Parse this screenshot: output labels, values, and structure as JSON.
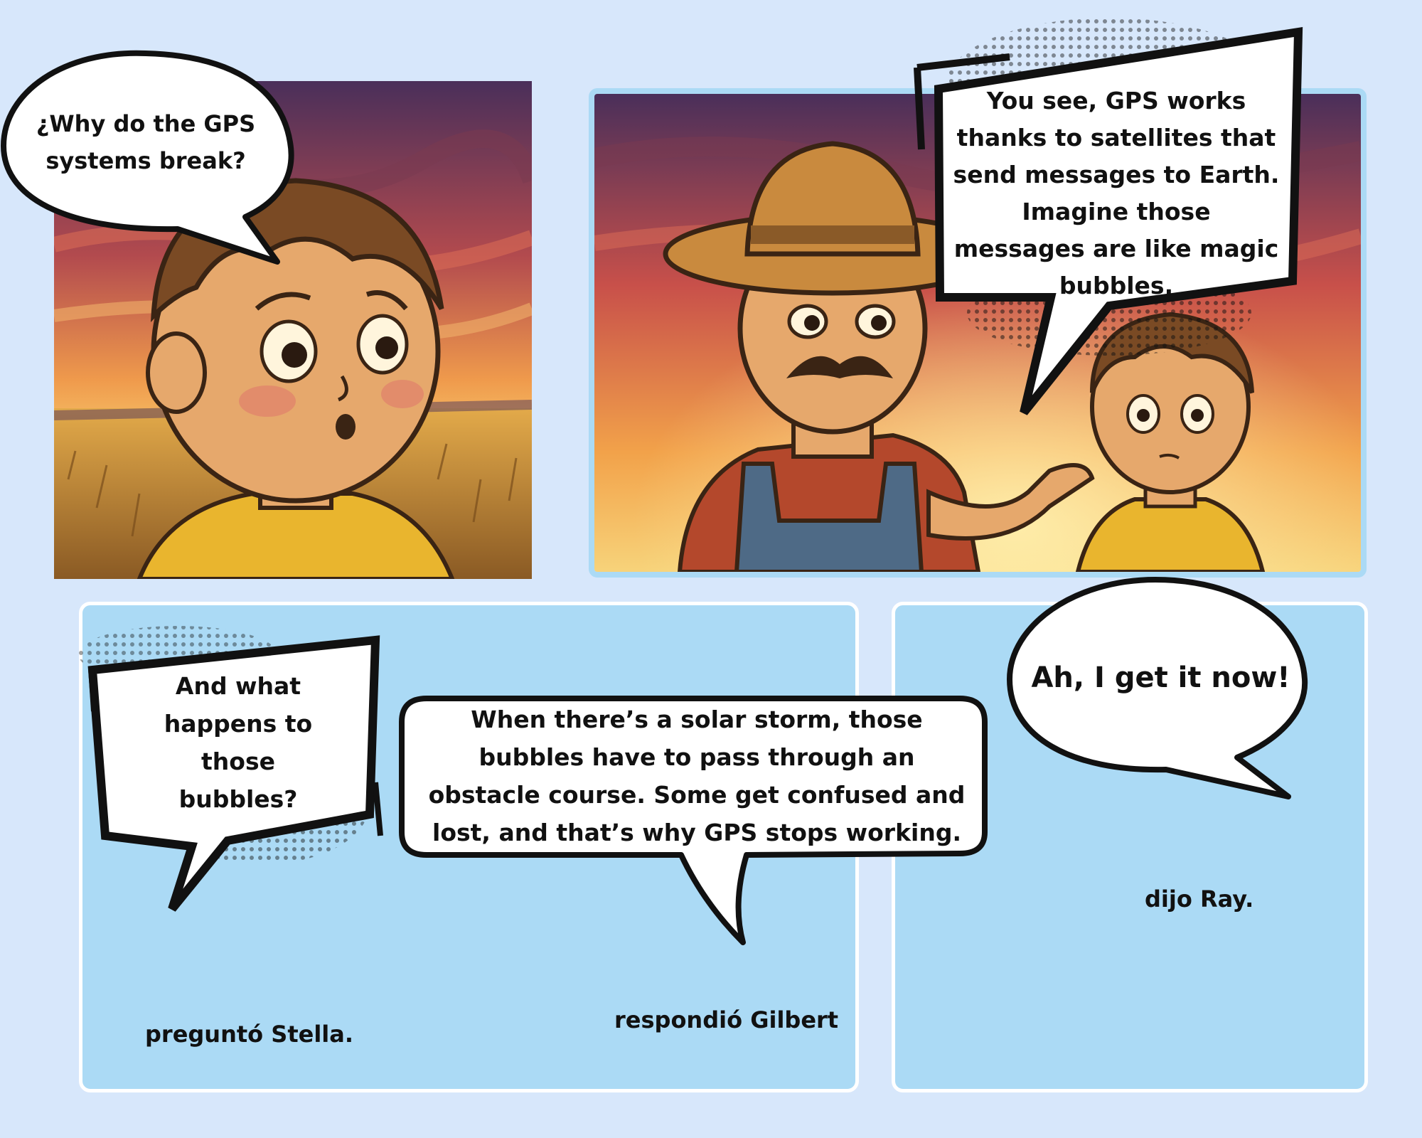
{
  "panels": {
    "p1": {
      "bubble": "¿Why do the GPS systems break?"
    },
    "p2": {
      "bubble": "You see, GPS works thanks to satellites that send messages to Earth. Imagine those messages are like magic bubbles."
    },
    "p3": {
      "bubble_left": "And what happens to those bubbles?",
      "bubble_right": "When there’s a solar storm, those bubbles have to pass through an obstacle course. Some get confused and lost, and that’s why GPS stops working.",
      "caption_left": "preguntó Stella.",
      "caption_right": "respondió Gilbert"
    },
    "p4": {
      "bubble": "Ah, I get it now!",
      "caption": "dijo Ray."
    }
  },
  "colors": {
    "page_bg": "#d7e7fb",
    "panel_blue": "#abdaf5",
    "sky_top": "#4a2f5a",
    "sky_mid": "#c8504a",
    "sky_low": "#f2a24a",
    "field": "#d49a3a",
    "skin": "#e6a86c",
    "hair": "#7a4a24",
    "shirt": "#e9b52e",
    "overalls": "#4e6a86",
    "plaid": "#b4482c",
    "hat": "#c98a3e"
  }
}
